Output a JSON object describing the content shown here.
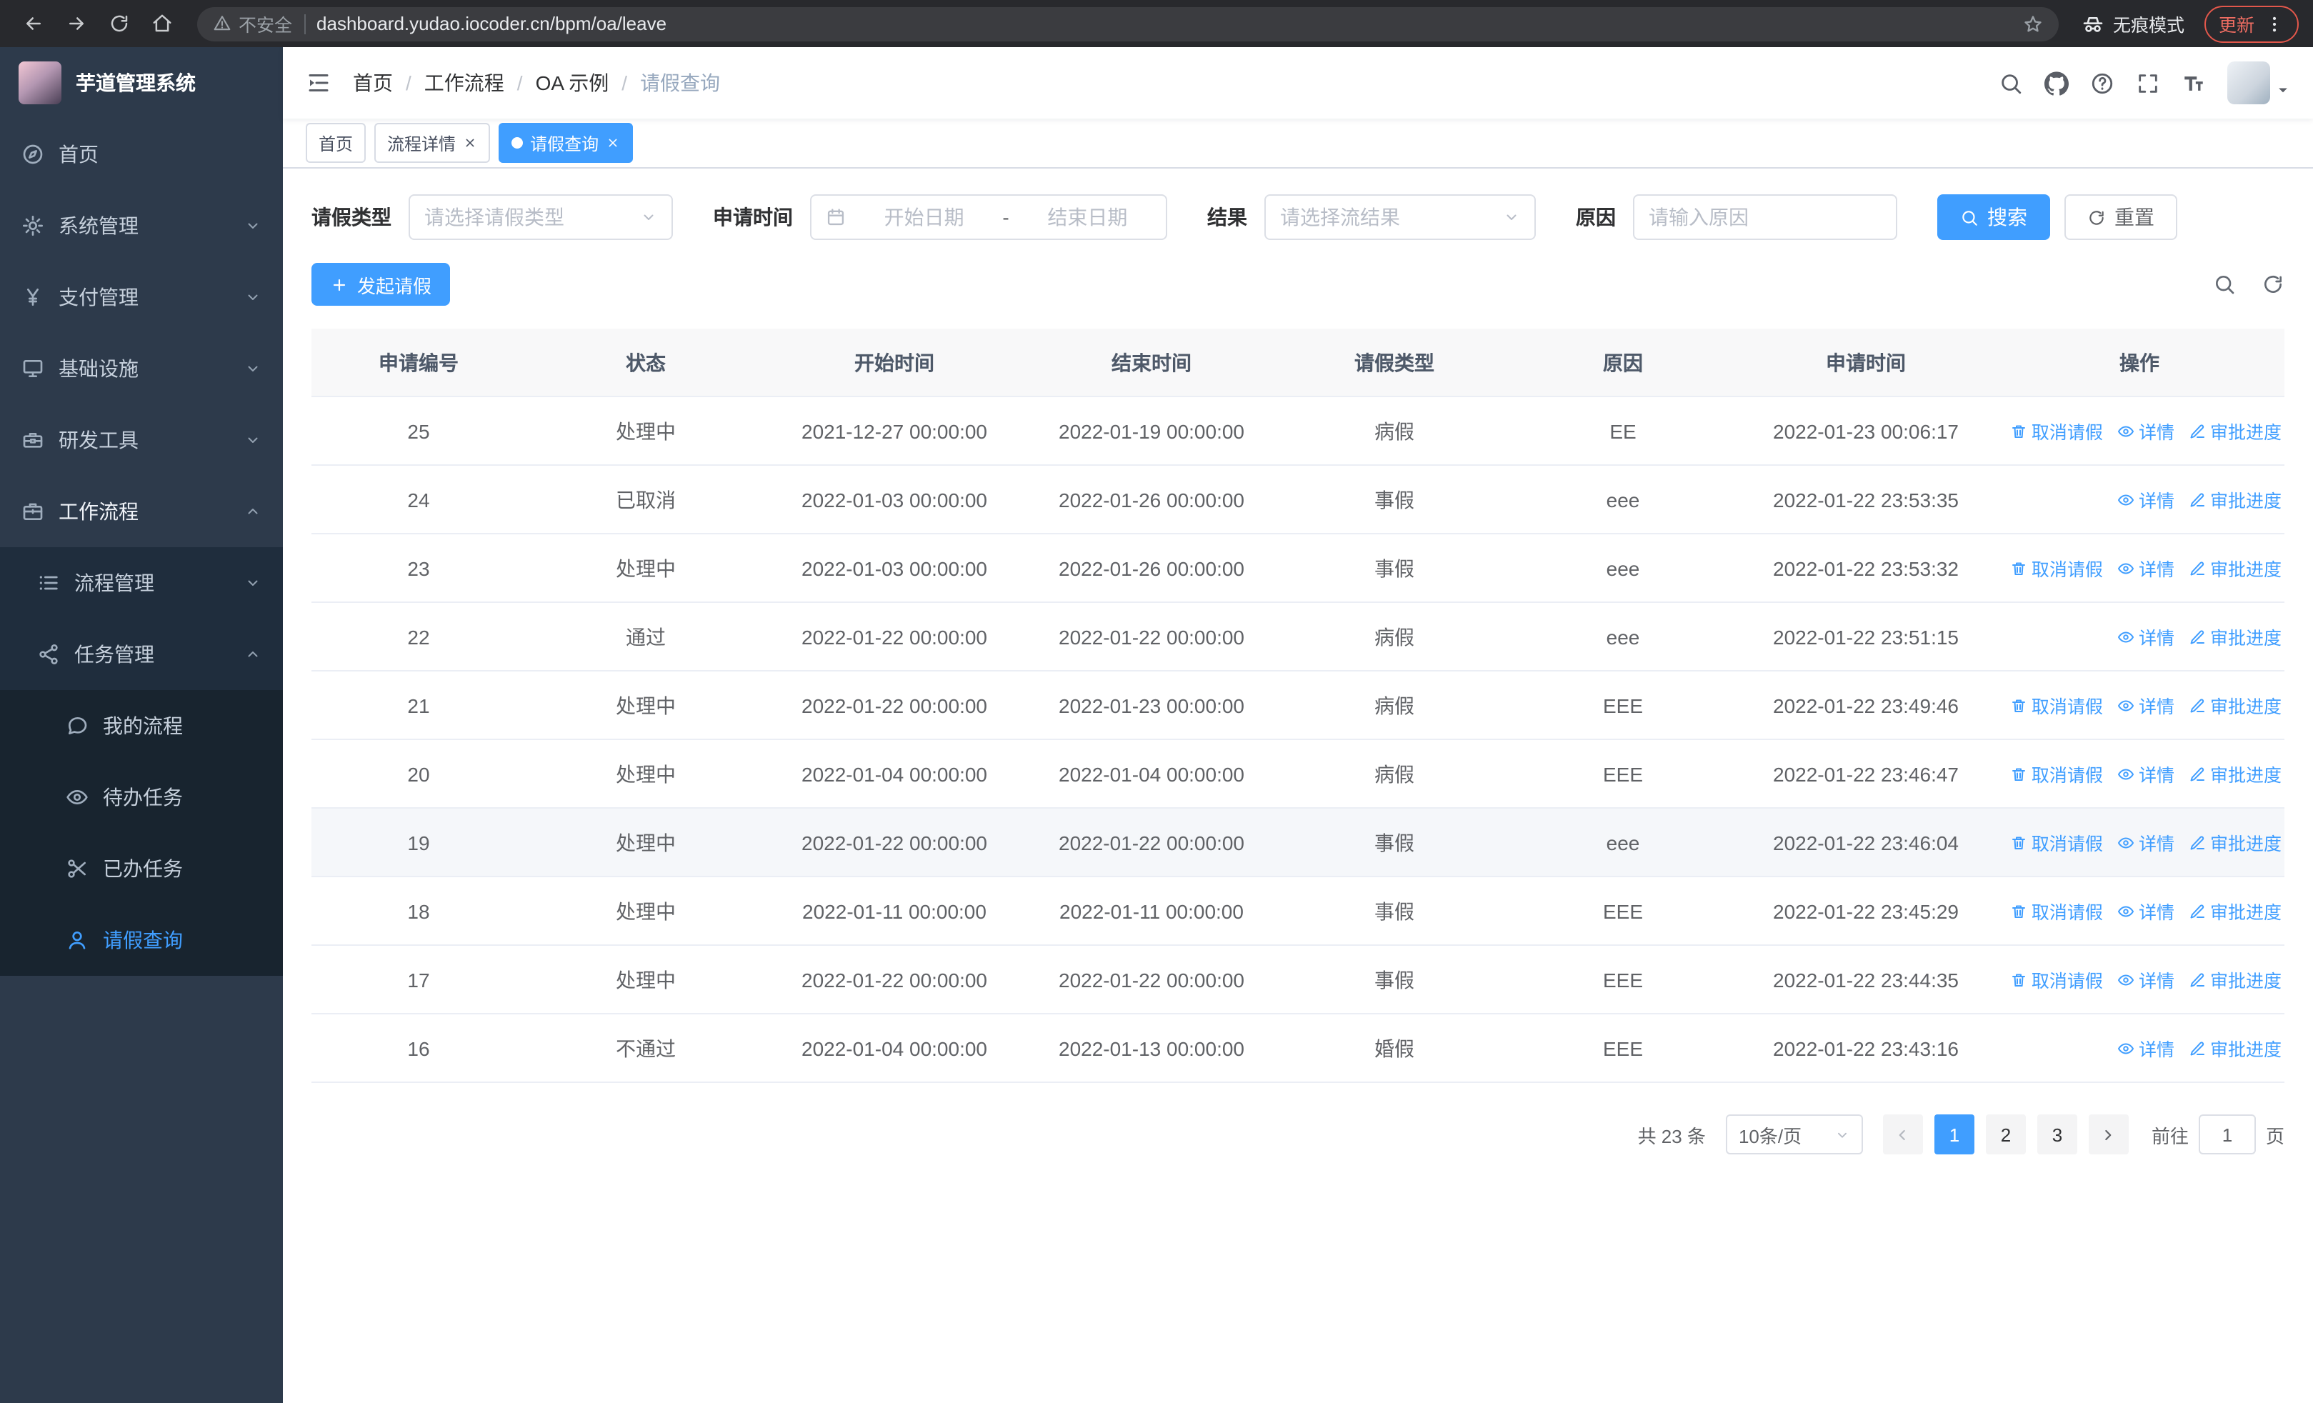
{
  "browser": {
    "security_label": "不安全",
    "url": "dashboard.yudao.iocoder.cn/bpm/oa/leave",
    "incognito_label": "无痕模式",
    "update_label": "更新"
  },
  "sidebar": {
    "logo_title": "芋道管理系统",
    "menu": [
      {
        "key": "home",
        "icon": "compass",
        "label": "首页",
        "level": 1
      },
      {
        "key": "system",
        "icon": "gear",
        "label": "系统管理",
        "level": 1,
        "chevron": "down"
      },
      {
        "key": "payment",
        "icon": "yen",
        "label": "支付管理",
        "level": 1,
        "chevron": "down"
      },
      {
        "key": "infrastructure",
        "icon": "monitor",
        "label": "基础设施",
        "level": 1,
        "chevron": "down"
      },
      {
        "key": "devtools",
        "icon": "toolbox",
        "label": "研发工具",
        "level": 1,
        "chevron": "down"
      },
      {
        "key": "workflow",
        "icon": "suitcase",
        "label": "工作流程",
        "level": 1,
        "chevron": "up",
        "expanded": true
      },
      {
        "key": "process-mgmt",
        "icon": "list",
        "label": "流程管理",
        "level": 2,
        "chevron": "down"
      },
      {
        "key": "task-mgmt",
        "icon": "share",
        "label": "任务管理",
        "level": 2,
        "chevron": "up"
      },
      {
        "key": "my-process",
        "icon": "chat",
        "label": "我的流程",
        "level": 3
      },
      {
        "key": "todo-task",
        "icon": "eye",
        "label": "待办任务",
        "level": 3
      },
      {
        "key": "done-task",
        "icon": "scissors",
        "label": "已办任务",
        "level": 3
      },
      {
        "key": "leave-query",
        "icon": "user",
        "label": "请假查询",
        "level": 3,
        "active": true
      }
    ]
  },
  "header": {
    "breadcrumb": [
      "首页",
      "工作流程",
      "OA 示例",
      "请假查询"
    ]
  },
  "tabs": [
    {
      "label": "首页",
      "closable": false,
      "active": false
    },
    {
      "label": "流程详情",
      "closable": true,
      "active": false
    },
    {
      "label": "请假查询",
      "closable": true,
      "active": true
    }
  ],
  "filters": {
    "leave_type": {
      "label": "请假类型",
      "placeholder": "请选择请假类型"
    },
    "apply_time": {
      "label": "申请时间",
      "start_placeholder": "开始日期",
      "separator": "-",
      "end_placeholder": "结束日期"
    },
    "result": {
      "label": "结果",
      "placeholder": "请选择流结果"
    },
    "reason": {
      "label": "原因",
      "placeholder": "请输入原因"
    },
    "search_label": "搜索",
    "reset_label": "重置"
  },
  "toolbar": {
    "create_label": "发起请假"
  },
  "table": {
    "columns": [
      "申请编号",
      "状态",
      "开始时间",
      "结束时间",
      "请假类型",
      "原因",
      "申请时间",
      "操作"
    ],
    "action_labels": {
      "cancel": "取消请假",
      "detail": "详情",
      "progress": "审批进度"
    },
    "action_icons": {
      "cancel": "trash",
      "detail": "eye",
      "progress": "edit"
    },
    "rows": [
      {
        "id": "25",
        "status": "处理中",
        "start": "2021-12-27 00:00:00",
        "end": "2022-01-19 00:00:00",
        "type": "病假",
        "reason": "EE",
        "applied": "2022-01-23 00:06:17",
        "actions": [
          "cancel",
          "detail",
          "progress"
        ]
      },
      {
        "id": "24",
        "status": "已取消",
        "start": "2022-01-03 00:00:00",
        "end": "2022-01-26 00:00:00",
        "type": "事假",
        "reason": "eee",
        "applied": "2022-01-22 23:53:35",
        "actions": [
          "detail",
          "progress"
        ]
      },
      {
        "id": "23",
        "status": "处理中",
        "start": "2022-01-03 00:00:00",
        "end": "2022-01-26 00:00:00",
        "type": "事假",
        "reason": "eee",
        "applied": "2022-01-22 23:53:32",
        "actions": [
          "cancel",
          "detail",
          "progress"
        ]
      },
      {
        "id": "22",
        "status": "通过",
        "start": "2022-01-22 00:00:00",
        "end": "2022-01-22 00:00:00",
        "type": "病假",
        "reason": "eee",
        "applied": "2022-01-22 23:51:15",
        "actions": [
          "detail",
          "progress"
        ]
      },
      {
        "id": "21",
        "status": "处理中",
        "start": "2022-01-22 00:00:00",
        "end": "2022-01-23 00:00:00",
        "type": "病假",
        "reason": "EEE",
        "applied": "2022-01-22 23:49:46",
        "actions": [
          "cancel",
          "detail",
          "progress"
        ]
      },
      {
        "id": "20",
        "status": "处理中",
        "start": "2022-01-04 00:00:00",
        "end": "2022-01-04 00:00:00",
        "type": "病假",
        "reason": "EEE",
        "applied": "2022-01-22 23:46:47",
        "actions": [
          "cancel",
          "detail",
          "progress"
        ]
      },
      {
        "id": "19",
        "status": "处理中",
        "start": "2022-01-22 00:00:00",
        "end": "2022-01-22 00:00:00",
        "type": "事假",
        "reason": "eee",
        "applied": "2022-01-22 23:46:04",
        "actions": [
          "cancel",
          "detail",
          "progress"
        ],
        "highlighted": true
      },
      {
        "id": "18",
        "status": "处理中",
        "start": "2022-01-11 00:00:00",
        "end": "2022-01-11 00:00:00",
        "type": "事假",
        "reason": "EEE",
        "applied": "2022-01-22 23:45:29",
        "actions": [
          "cancel",
          "detail",
          "progress"
        ]
      },
      {
        "id": "17",
        "status": "处理中",
        "start": "2022-01-22 00:00:00",
        "end": "2022-01-22 00:00:00",
        "type": "事假",
        "reason": "EEE",
        "applied": "2022-01-22 23:44:35",
        "actions": [
          "cancel",
          "detail",
          "progress"
        ]
      },
      {
        "id": "16",
        "status": "不通过",
        "start": "2022-01-04 00:00:00",
        "end": "2022-01-13 00:00:00",
        "type": "婚假",
        "reason": "EEE",
        "applied": "2022-01-22 23:43:16",
        "actions": [
          "detail",
          "progress"
        ]
      }
    ]
  },
  "pagination": {
    "total": "共 23 条",
    "page_size": "10条/页",
    "pages": [
      "1",
      "2",
      "3"
    ],
    "active_page": "1",
    "goto_label": "前往",
    "goto_value": "1",
    "goto_suffix": "页"
  }
}
